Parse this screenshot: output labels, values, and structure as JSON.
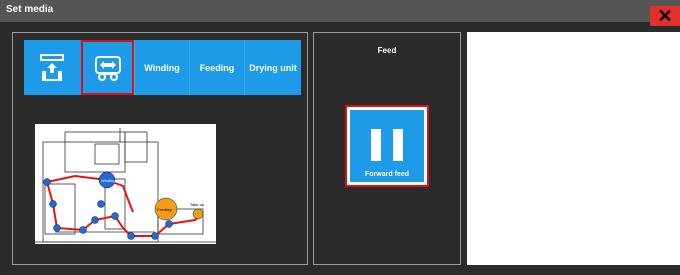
{
  "window": {
    "title": "Set media",
    "close_symbol": "✕"
  },
  "toolbar": {
    "items": [
      {
        "icon": "media-set-icon",
        "label": ""
      },
      {
        "icon": "transfer-icon",
        "label": "",
        "selected": true
      },
      {
        "icon": "",
        "label": "Winding"
      },
      {
        "icon": "",
        "label": "Feeding"
      },
      {
        "icon": "",
        "label": "Drying unit"
      }
    ]
  },
  "diagram": {
    "labels": [
      "Winding",
      "Feeding",
      "Take-up"
    ]
  },
  "feed": {
    "title": "Feed",
    "button_label": "Forward feed",
    "button_icon": "pause-icon"
  },
  "colors": {
    "accent": "#1e9be8",
    "highlight": "#dd1111",
    "close": "#e0302a",
    "background": "#2b2b2b"
  }
}
